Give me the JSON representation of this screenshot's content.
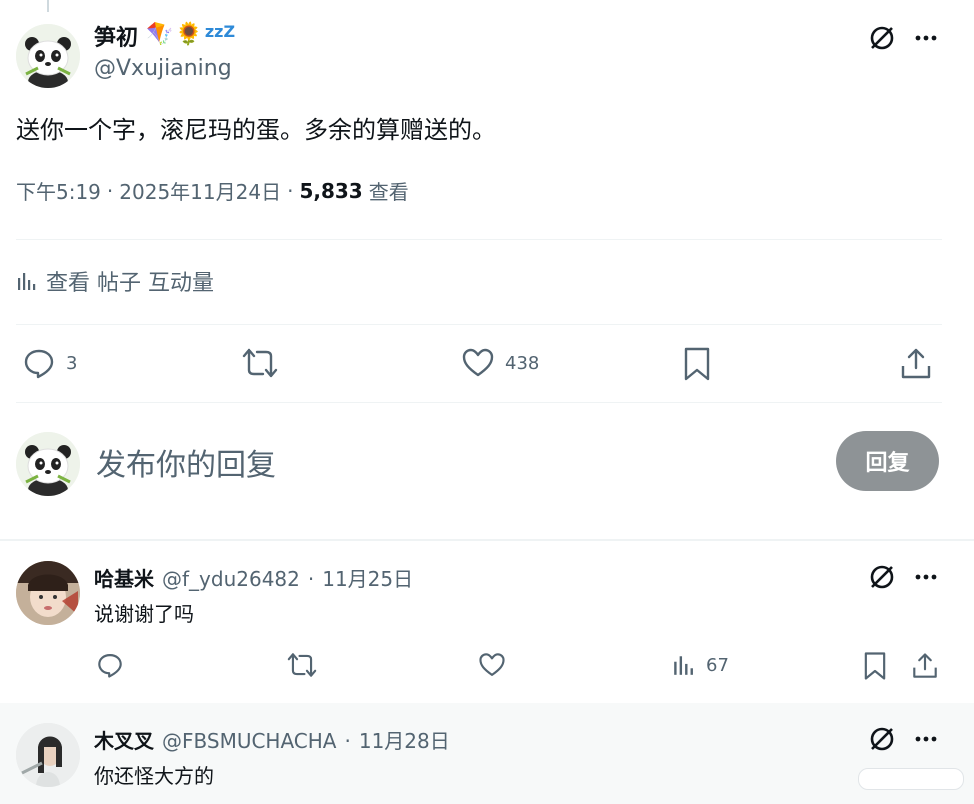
{
  "main_post": {
    "display_name": "笋初",
    "emoji_kite": "🪁",
    "emoji_flower": "🌻",
    "emoji_zzz": "zzZ",
    "handle": "@Vxujianing",
    "text": "送你一个字，滚尼玛的蛋。多余的算赠送的。",
    "time": "下午5:19",
    "date": "2025年11月24日",
    "dot": "·",
    "views_count": "5,833",
    "views_label": "查看",
    "analytics_label": "查看 帖子 互动量",
    "actions": {
      "replies": "3",
      "likes": "438"
    }
  },
  "reply_composer": {
    "placeholder": "发布你的回复",
    "button_label": "回复"
  },
  "replies": [
    {
      "name": "哈基米",
      "handle": "@f_ydu26482",
      "date": "11月25日",
      "text": "说谢谢了吗",
      "views": "67"
    },
    {
      "name": "木叉叉",
      "handle": "@FBSMUCHACHA",
      "date": "11月28日",
      "text": "你还怪大方的"
    }
  ]
}
